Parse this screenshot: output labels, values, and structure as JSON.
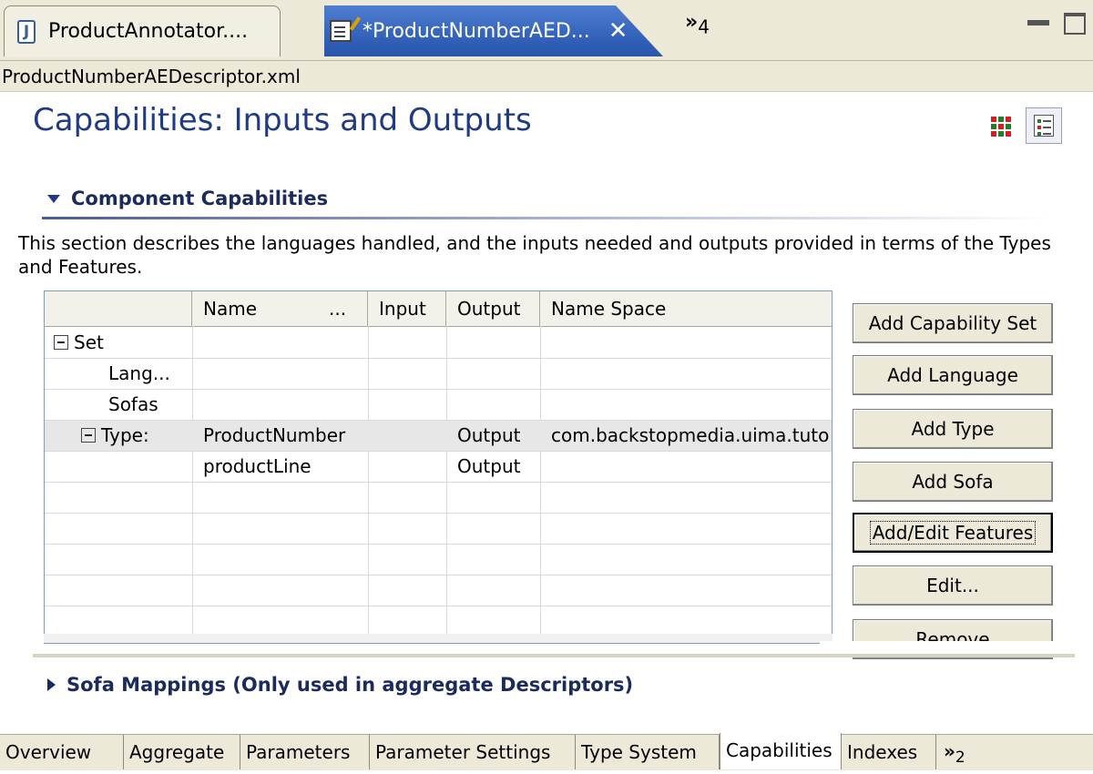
{
  "editor_tabs": [
    {
      "label": "ProductAnnotator...."
    },
    {
      "label": "*ProductNumberAED..."
    }
  ],
  "tab_overflow": {
    "symbol": "»",
    "count": "4"
  },
  "breadcrumb": "ProductNumberAEDescriptor.xml",
  "page_title": "Capabilities: Inputs and Outputs",
  "section": {
    "title": "Component Capabilities",
    "description": "This section describes the languages handled, and the inputs needed and outputs provided in terms of the Types and Features."
  },
  "table": {
    "headers": [
      "",
      "Name",
      "...",
      "Input",
      "Output",
      "Name Space"
    ],
    "rows": [
      {
        "col0": "Set",
        "name": "",
        "input": "",
        "output": "",
        "ns": ""
      },
      {
        "col0": "Lang...",
        "name": "",
        "input": "",
        "output": "",
        "ns": ""
      },
      {
        "col0": "Sofas",
        "name": "",
        "input": "",
        "output": "",
        "ns": ""
      },
      {
        "col0": "Type:",
        "name": "ProductNumber",
        "input": "",
        "output": "Output",
        "ns": "com.backstopmedia.uima.tuto"
      },
      {
        "col0": "",
        "name": "productLine",
        "input": "",
        "output": "Output",
        "ns": ""
      }
    ]
  },
  "buttons": {
    "add_capability_set": "Add Capability Set",
    "add_language": "Add Language",
    "add_type": "Add Type",
    "add_sofa": "Add Sofa",
    "add_edit_features": "Add/Edit Features",
    "edit": "Edit...",
    "remove": "Remove"
  },
  "sofa_section": {
    "title": "Sofa Mappings (Only used in aggregate Descriptors)"
  },
  "page_tabs": [
    "Overview",
    "Aggregate",
    "Parameters",
    "Parameter Settings",
    "Type System",
    "Capabilities",
    "Indexes"
  ],
  "active_page_tab": "Capabilities",
  "page_tab_overflow": {
    "symbol": "»",
    "count": "2"
  },
  "colors": {
    "title": "#1f3b84",
    "active_tab": "#2f5fb7",
    "background": "#ece9d8"
  }
}
